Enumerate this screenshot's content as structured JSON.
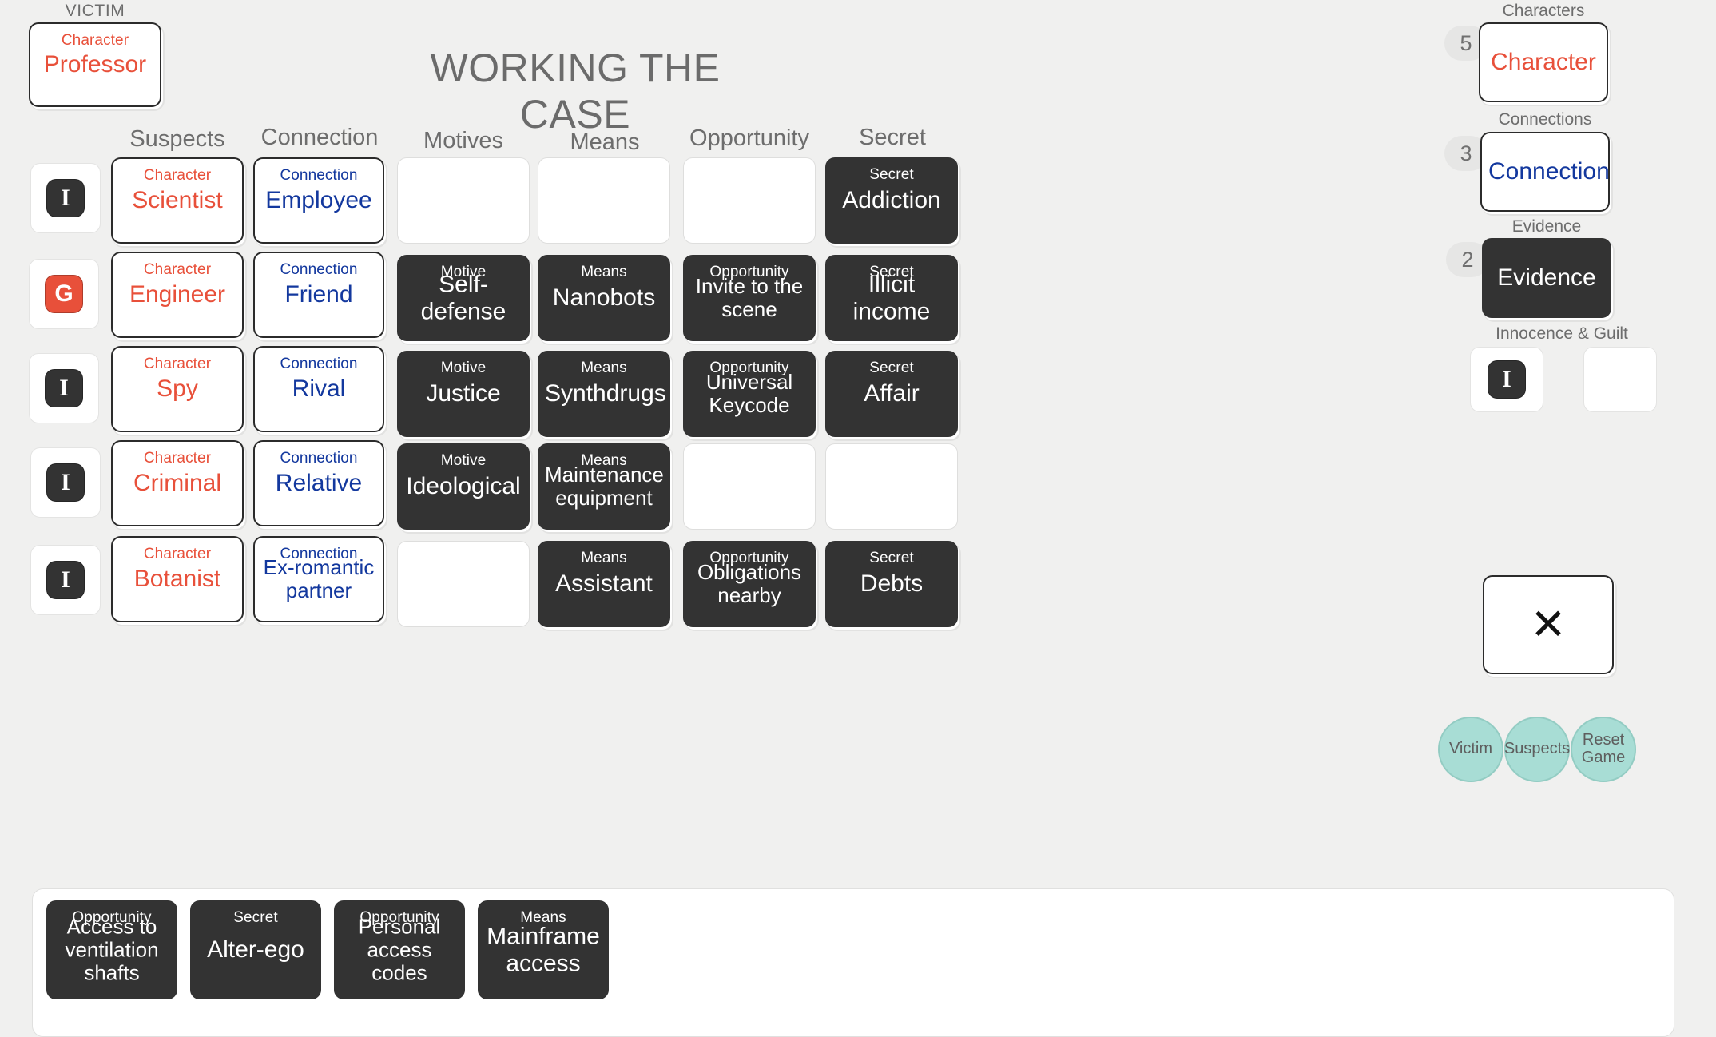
{
  "header": {
    "victim_label": "VICTIM",
    "title": "WORKING THE CASE",
    "victim_card": {
      "kind": "Character",
      "title": "Professor"
    }
  },
  "columns": [
    {
      "label": "Suspects"
    },
    {
      "label": "Connection"
    },
    {
      "label": "Motives"
    },
    {
      "label": "Means"
    },
    {
      "label": "Opportunity"
    },
    {
      "label": "Secret"
    }
  ],
  "rows": [
    {
      "verdict": "I",
      "suspect": {
        "kind": "Character",
        "title": "Scientist"
      },
      "connection": {
        "kind": "Connection",
        "title": "Employee"
      },
      "motive": {
        "kind": "",
        "title": ""
      },
      "means": {
        "kind": "",
        "title": ""
      },
      "opportunity": {
        "kind": "",
        "title": ""
      },
      "secret": {
        "kind": "Secret",
        "title": "Addiction"
      }
    },
    {
      "verdict": "G",
      "suspect": {
        "kind": "Character",
        "title": "Engineer"
      },
      "connection": {
        "kind": "Connection",
        "title": "Friend"
      },
      "motive": {
        "kind": "Motive",
        "title": "Self-defense"
      },
      "means": {
        "kind": "Means",
        "title": "Nanobots"
      },
      "opportunity": {
        "kind": "Opportunity",
        "title": "Invite to the scene"
      },
      "secret": {
        "kind": "Secret",
        "title": "Illicit income"
      }
    },
    {
      "verdict": "I",
      "suspect": {
        "kind": "Character",
        "title": "Spy"
      },
      "connection": {
        "kind": "Connection",
        "title": "Rival"
      },
      "motive": {
        "kind": "Motive",
        "title": "Justice"
      },
      "means": {
        "kind": "Means",
        "title": "Synthdrugs"
      },
      "opportunity": {
        "kind": "Opportunity",
        "title": "Universal Keycode"
      },
      "secret": {
        "kind": "Secret",
        "title": "Affair"
      }
    },
    {
      "verdict": "I",
      "suspect": {
        "kind": "Character",
        "title": "Criminal"
      },
      "connection": {
        "kind": "Connection",
        "title": "Relative"
      },
      "motive": {
        "kind": "Motive",
        "title": "Ideological"
      },
      "means": {
        "kind": "Means",
        "title": "Maintenance equipment"
      },
      "opportunity": {
        "kind": "",
        "title": ""
      },
      "secret": {
        "kind": "",
        "title": ""
      }
    },
    {
      "verdict": "I",
      "suspect": {
        "kind": "Character",
        "title": "Botanist"
      },
      "connection": {
        "kind": "Connection",
        "title": "Ex-romantic partner"
      },
      "motive": {
        "kind": "",
        "title": ""
      },
      "means": {
        "kind": "Means",
        "title": "Assistant"
      },
      "opportunity": {
        "kind": "Opportunity",
        "title": "Obligations nearby"
      },
      "secret": {
        "kind": "Secret",
        "title": "Debts"
      }
    }
  ],
  "rail": {
    "characters": {
      "label": "Characters",
      "count": "5",
      "card_title": "Character"
    },
    "connections": {
      "label": "Connections",
      "count": "3",
      "card_title": "Connection"
    },
    "evidence": {
      "label": "Evidence",
      "count": "2",
      "card_title": "Evidence"
    },
    "innocence_guilt": {
      "label": "Innocence & Guilt",
      "token": "I",
      "x_glyph": "✕"
    },
    "buttons": [
      {
        "label": "Victim"
      },
      {
        "label": "Suspects"
      },
      {
        "label": "Reset\nGame"
      }
    ]
  },
  "hand": [
    {
      "kind": "Opportunity",
      "title": "Access to ventilation shafts"
    },
    {
      "kind": "Secret",
      "title": "Alter-ego"
    },
    {
      "kind": "Opportunity",
      "title": "Personal access codes"
    },
    {
      "kind": "Means",
      "title": "Mainframe access"
    }
  ],
  "colors": {
    "character": "#e8503a",
    "connection": "#13389e",
    "card_back": "#333333",
    "guilty": "#e8503a",
    "button": "#a8ddd5",
    "background": "#f0f0ef"
  }
}
